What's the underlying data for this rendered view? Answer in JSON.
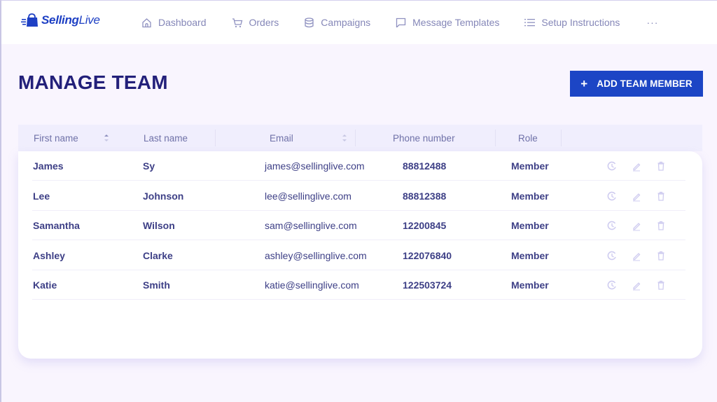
{
  "app": {
    "logo_bold": "Selling",
    "logo_light": "Live",
    "brand_color": "#1c45c5"
  },
  "nav": {
    "items": [
      {
        "label": "Dashboard",
        "icon": "home-icon"
      },
      {
        "label": "Orders",
        "icon": "cart-icon"
      },
      {
        "label": "Campaigns",
        "icon": "database-icon"
      },
      {
        "label": "Message Templates",
        "icon": "message-icon"
      },
      {
        "label": "Setup Instructions",
        "icon": "list-icon"
      }
    ],
    "more_label": "···"
  },
  "page": {
    "title": "MANAGE TEAM",
    "add_button_label": "ADD TEAM MEMBER",
    "add_button_icon": "+"
  },
  "table": {
    "columns": [
      {
        "label": "First name",
        "sortable": true
      },
      {
        "label": "Last name",
        "sortable": false
      },
      {
        "label": "Email",
        "sortable": true
      },
      {
        "label": "Phone number",
        "sortable": false
      },
      {
        "label": "Role",
        "sortable": false
      }
    ],
    "rows": [
      {
        "first": "James",
        "last": "Sy",
        "email": "james@sellinglive.com",
        "phone": "88812488",
        "role": "Member"
      },
      {
        "first": "Lee",
        "last": "Johnson",
        "email": "lee@sellinglive.com",
        "phone": "88812388",
        "role": "Member"
      },
      {
        "first": "Samantha",
        "last": "Wilson",
        "email": "sam@sellinglive.com",
        "phone": "12200845",
        "role": "Member"
      },
      {
        "first": "Ashley",
        "last": "Clarke",
        "email": "ashley@sellinglive.com",
        "phone": "122076840",
        "role": "Member"
      },
      {
        "first": "Katie",
        "last": "Smith",
        "email": "katie@sellinglive.com",
        "phone": "122503724",
        "role": "Member"
      }
    ],
    "row_actions": [
      "history-icon",
      "edit-icon",
      "delete-icon"
    ]
  }
}
